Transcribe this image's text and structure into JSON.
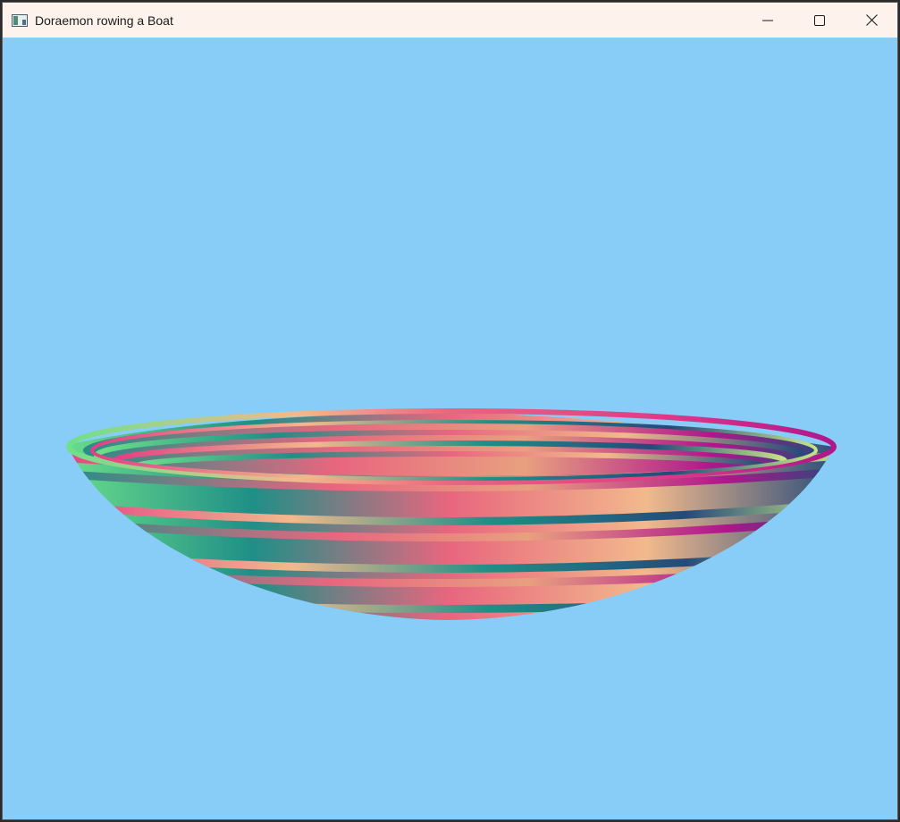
{
  "window": {
    "title": "Doraemon rowing a Boat",
    "icon": "app-window-icon",
    "controls": [
      "minimize-icon",
      "maximize-icon",
      "close-icon"
    ]
  },
  "scene": {
    "background_color": "#87cdf8",
    "object": "boat",
    "stripe_colors": [
      "#e8667f",
      "#f2b98c",
      "#1f8f87",
      "#244a7a",
      "#6ee08a",
      "#b0168c",
      "#e23f86",
      "#c6e48a"
    ]
  }
}
